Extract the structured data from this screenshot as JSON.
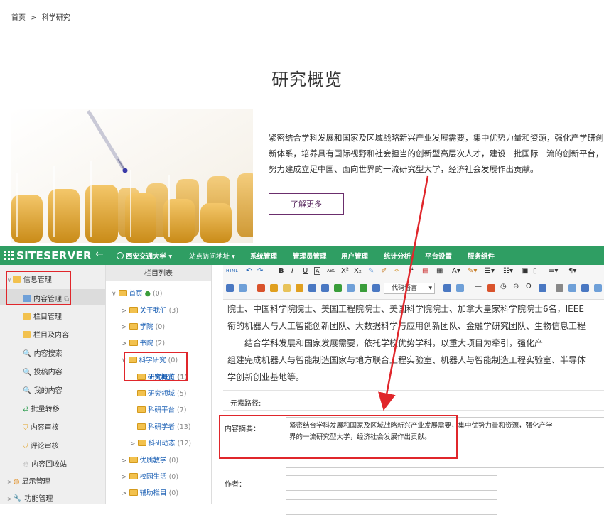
{
  "breadcrumb": {
    "home": "首页",
    "sep": ">",
    "current": "科学研究"
  },
  "page_title": "研究概览",
  "intro": {
    "lines": [
      "紧密结合学科发展和国家及区域战略新兴产业发展需要，集中优势力量和资源，强化产学研创",
      "新体系，培养具有国际视野和社会担当的创新型高层次人才，建设一批国际一流的创新平台，",
      "努力建成立足中国、面向世界的一流研究型大学，经济社会发展作出贡献。"
    ],
    "button": "了解更多"
  },
  "cms": {
    "logo": "SITESERVER",
    "back_icon": "arrow-left-icon",
    "site": "西安交通大学",
    "nav": [
      "站点访问地址",
      "系统管理",
      "管理员管理",
      "用户管理",
      "统计分析",
      "平台设置",
      "服务组件"
    ],
    "colors": {
      "topbar": "#2f9e63",
      "highlight": "#e0262b"
    },
    "left_nav": {
      "group": "信息管理",
      "items": [
        "内容管理",
        "栏目管理",
        "栏目及内容",
        "内容搜索",
        "投稿内容",
        "我的内容",
        "批量转移",
        "内容审核",
        "评论审核",
        "内容回收站"
      ],
      "bottom": [
        "显示管理",
        "功能管理"
      ]
    },
    "tree": {
      "header": "栏目列表",
      "root": {
        "label": "首页",
        "count": "(0)"
      },
      "nodes": [
        {
          "label": "关于我们",
          "count": "(3)"
        },
        {
          "label": "学院",
          "count": "(0)"
        },
        {
          "label": "书院",
          "count": "(2)"
        },
        {
          "label": "科学研究",
          "count": "(0)"
        },
        {
          "label": "研究概览",
          "count": "(1)"
        },
        {
          "label": "研究领域",
          "count": "(5)"
        },
        {
          "label": "科研平台",
          "count": "(7)"
        },
        {
          "label": "科研学者",
          "count": "(13)"
        },
        {
          "label": "科研动态",
          "count": "(12)"
        },
        {
          "label": "优质教学",
          "count": "(0)"
        },
        {
          "label": "校园生活",
          "count": "(0)"
        },
        {
          "label": "辅助栏目",
          "count": "(0)"
        }
      ]
    },
    "editor": {
      "code_lang": "代码语言",
      "content_lines": [
        "院士、中国科学院院士、美国工程院院士、美国科学院院士、加拿大皇家科学院院士6名，IEEE",
        "衔的机器人与人工智能创新团队、大数据科学与应用创新团队、金融学研究团队、生物信息工程",
        "　　结合学科发展和国家发展需要，依托学校优势学科，以重大项目为牵引，强化产",
        "组建完成机器人与智能制造国家与地方联合工程实验室、机器人与智能制造工程实验室、半导体",
        "学创新创业基地等。"
      ],
      "element_path": "元素路径:",
      "summary_label": "内容摘要：",
      "summary_lines": [
        "紧密结合学科发展和国家及区域战略新兴产业发展需要，集中优势力量和资源，强化产学",
        "界的一流研究型大学，经济社会发展作出贡献。"
      ],
      "author_label": "作者："
    }
  }
}
